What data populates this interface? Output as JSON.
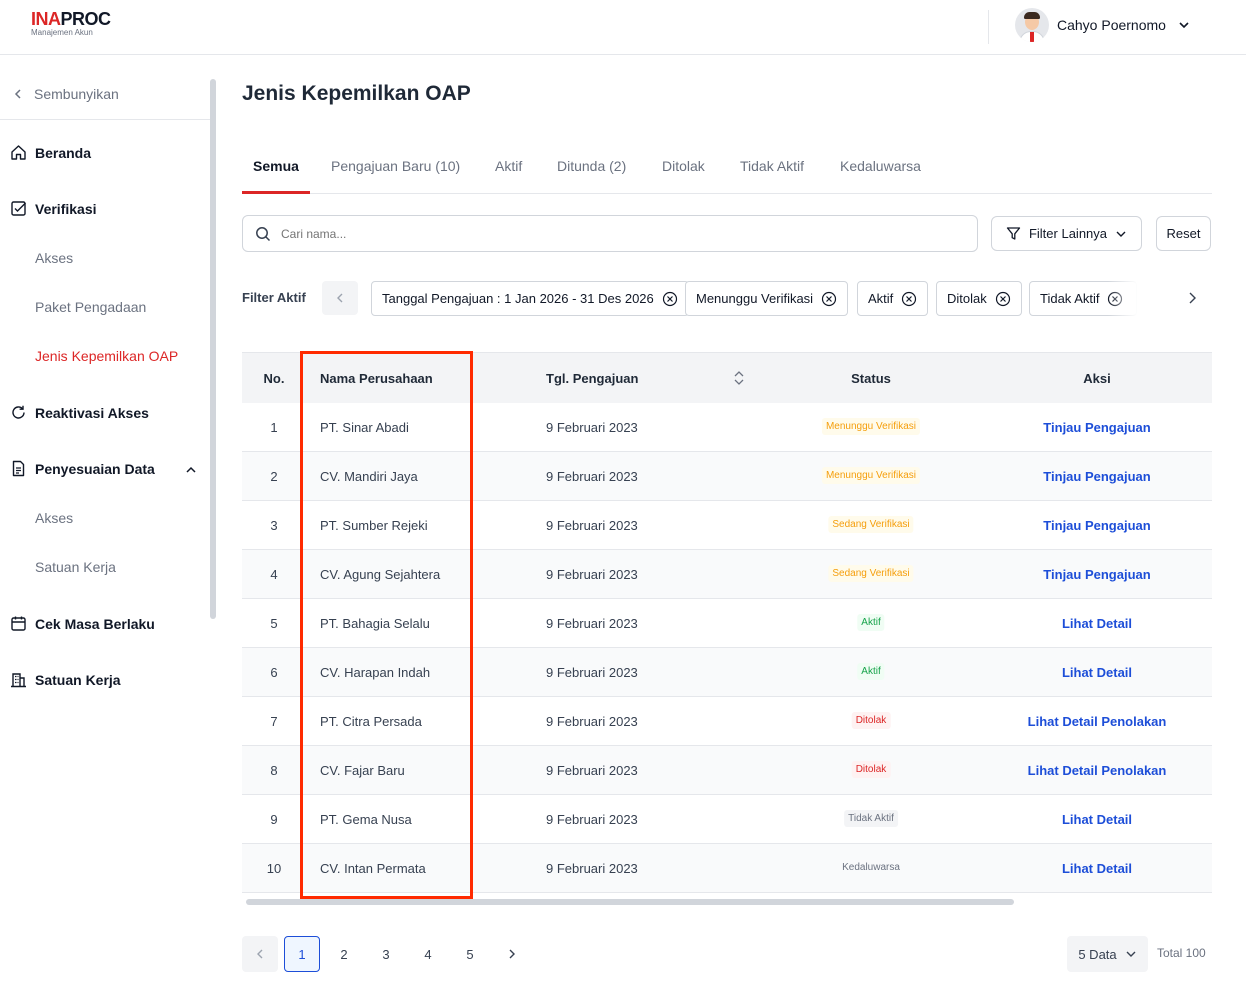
{
  "header": {
    "logo_brand_a": "INA",
    "logo_brand_b": "PROC",
    "logo_subtitle": "Manajemen Akun",
    "user_name": "Cahyo Poernomo"
  },
  "sidebar": {
    "hide_label": "Sembunyikan",
    "items": [
      {
        "label": "Beranda"
      },
      {
        "label": "Verifikasi"
      },
      {
        "label": "Akses"
      },
      {
        "label": "Paket Pengadaan"
      },
      {
        "label": "Jenis Kepemilkan OAP"
      },
      {
        "label": "Reaktivasi Akses"
      },
      {
        "label": "Penyesuaian Data"
      },
      {
        "label": "Akses"
      },
      {
        "label": "Satuan Kerja"
      },
      {
        "label": "Cek Masa Berlaku"
      },
      {
        "label": "Satuan Kerja"
      }
    ]
  },
  "page": {
    "title": "Jenis Kepemilkan OAP"
  },
  "tabs": [
    {
      "label": "Semua",
      "active": true
    },
    {
      "label": "Pengajuan Baru (10)"
    },
    {
      "label": "Aktif"
    },
    {
      "label": "Ditunda (2)"
    },
    {
      "label": "Ditolak"
    },
    {
      "label": "Tidak Aktif"
    },
    {
      "label": "Kedaluwarsa"
    }
  ],
  "search": {
    "placeholder": "Cari nama..."
  },
  "toolbar": {
    "filter_label": "Filter Lainnya",
    "reset_label": "Reset"
  },
  "active_filters": {
    "label": "Filter Aktif",
    "chips": [
      "Tanggal Pengajuan : 1 Jan 2026 - 31 Des 2026",
      "Menunggu Verifikasi",
      "Aktif",
      "Ditolak",
      "Tidak Aktif"
    ]
  },
  "table": {
    "columns": [
      "No.",
      "Nama Perusahaan",
      "Tgl. Pengajuan",
      "Status",
      "Aksi"
    ],
    "rows": [
      {
        "no": "1",
        "name": "PT. Sinar Abadi",
        "date": "9 Februari 2023",
        "status": "Menunggu Verifikasi",
        "action": "Tinjau Pengajuan"
      },
      {
        "no": "2",
        "name": "CV. Mandiri Jaya",
        "date": "9 Februari 2023",
        "status": "Menunggu Verifikasi",
        "action": "Tinjau Pengajuan"
      },
      {
        "no": "3",
        "name": "PT. Sumber Rejeki",
        "date": "9 Februari 2023",
        "status": "Sedang Verifikasi",
        "action": "Tinjau Pengajuan"
      },
      {
        "no": "4",
        "name": "CV. Agung Sejahtera",
        "date": "9 Februari 2023",
        "status": "Sedang Verifikasi",
        "action": "Tinjau Pengajuan"
      },
      {
        "no": "5",
        "name": "PT. Bahagia Selalu",
        "date": "9 Februari 2023",
        "status": "Aktif",
        "action": "Lihat Detail"
      },
      {
        "no": "6",
        "name": "CV. Harapan Indah",
        "date": "9 Februari 2023",
        "status": "Aktif",
        "action": "Lihat Detail"
      },
      {
        "no": "7",
        "name": "PT. Citra Persada",
        "date": "9 Februari 2023",
        "status": "Ditolak",
        "action": "Lihat Detail Penolakan"
      },
      {
        "no": "8",
        "name": "CV. Fajar Baru",
        "date": "9 Februari 2023",
        "status": "Ditolak",
        "action": "Lihat Detail Penolakan"
      },
      {
        "no": "9",
        "name": "PT. Gema Nusa",
        "date": "9 Februari 2023",
        "status": "Tidak Aktif",
        "action": "Lihat Detail"
      },
      {
        "no": "10",
        "name": "CV. Intan Permata",
        "date": "9 Februari 2023",
        "status": "Kedaluwarsa",
        "action": "Lihat Detail"
      }
    ]
  },
  "pagination": {
    "pages": [
      "1",
      "2",
      "3",
      "4",
      "5"
    ],
    "current": "1",
    "per_page": "5 Data",
    "total": "Total 100"
  },
  "colors": {
    "brand_red": "#dc2626",
    "link_blue": "#1d4ed8",
    "highlight_box": "#ff2a00"
  }
}
